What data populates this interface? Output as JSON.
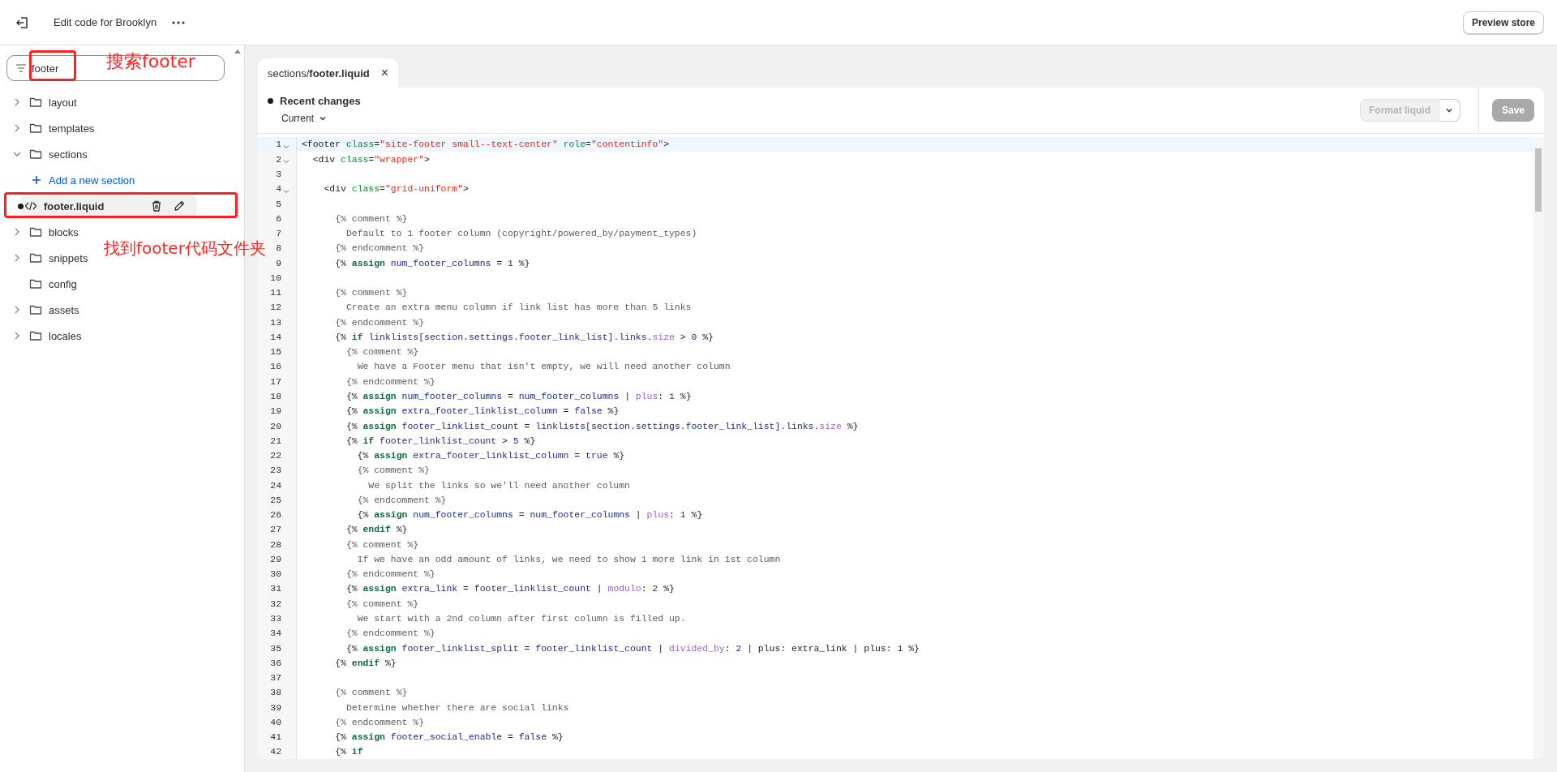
{
  "topbar": {
    "title": "Edit code for Brooklyn",
    "preview_button": "Preview store"
  },
  "search": {
    "value": "footer"
  },
  "tree": [
    {
      "kind": "folder",
      "label": "layout",
      "expanded": false
    },
    {
      "kind": "folder",
      "label": "templates",
      "expanded": false
    },
    {
      "kind": "folder",
      "label": "sections",
      "expanded": true,
      "children": [
        {
          "kind": "action",
          "label": "Add a new section"
        },
        {
          "kind": "file",
          "label": "footer.liquid",
          "selected": true,
          "modified": true
        }
      ]
    },
    {
      "kind": "folder",
      "label": "blocks",
      "expanded": false
    },
    {
      "kind": "folder",
      "label": "snippets",
      "expanded": false
    },
    {
      "kind": "plain-folder",
      "label": "config"
    },
    {
      "kind": "folder",
      "label": "assets",
      "expanded": false
    },
    {
      "kind": "folder",
      "label": "locales",
      "expanded": false
    }
  ],
  "editor": {
    "tab": {
      "label": "sections/**footer.liquid**",
      "close": "×"
    },
    "header": {
      "title": "Recent changes",
      "version": "Current"
    },
    "format_button": {
      "label": "Format liquid",
      "disabled": true
    },
    "save_button": {
      "label": "Save",
      "disabled": true
    },
    "lines": [
      {
        "n": "1",
        "fold": true,
        "active": true,
        "tokens": [
          {
            "kind": "tag",
            "text": "<footer "
          },
          {
            "kind": "attr",
            "text": "class"
          },
          {
            "kind": "tag",
            "text": "="
          },
          {
            "kind": "str",
            "text": "\"site-footer small--text-center\" "
          },
          {
            "kind": "attr",
            "text": "role"
          },
          {
            "kind": "tag",
            "text": "="
          },
          {
            "kind": "str",
            "text": "\"contentinfo\""
          },
          {
            "kind": "tag",
            "text": ">"
          }
        ]
      },
      {
        "n": "2",
        "fold": true,
        "active": false,
        "tokens": [
          {
            "kind": "tag",
            "text": "  <div "
          },
          {
            "kind": "attr",
            "text": "class"
          },
          {
            "kind": "tag",
            "text": "="
          },
          {
            "kind": "str",
            "text": "\"wrapper\""
          },
          {
            "kind": "tag",
            "text": ">"
          }
        ]
      },
      {
        "n": "3",
        "fold": false,
        "active": false
      },
      {
        "n": "4",
        "fold": true,
        "active": false,
        "tokens": [
          {
            "kind": "tag",
            "text": "    <div "
          },
          {
            "kind": "attr",
            "text": "class"
          },
          {
            "kind": "tag",
            "text": "="
          },
          {
            "kind": "str",
            "text": "\"grid-uniform\""
          },
          {
            "kind": "tag",
            "text": ">"
          }
        ]
      },
      {
        "n": "5",
        "fold": false,
        "active": false
      },
      {
        "n": "6",
        "fold": false,
        "active": false,
        "tokens": [
          {
            "kind": "cmt",
            "text": "      {% comment %}"
          }
        ]
      },
      {
        "n": "7",
        "fold": false,
        "active": false,
        "tokens": [
          {
            "kind": "cmt",
            "text": "        Default to 1 footer column (copyright/powered_by/payment_types)"
          }
        ]
      },
      {
        "n": "8",
        "fold": false,
        "active": false,
        "tokens": [
          {
            "kind": "cmt",
            "text": "      {% endcomment %}"
          }
        ]
      },
      {
        "n": "9",
        "fold": false,
        "active": false,
        "tokens": [
          {
            "kind": "text",
            "text": "      {% "
          },
          {
            "kind": "kw",
            "text": "assign"
          },
          {
            "kind": "var",
            "text": " num_footer_columns "
          },
          {
            "kind": "text",
            "text": "= "
          },
          {
            "kind": "var",
            "text": "1"
          },
          {
            "kind": "text",
            "text": " %}"
          }
        ]
      },
      {
        "n": "10",
        "fold": false,
        "active": false
      },
      {
        "n": "11",
        "fold": false,
        "active": false,
        "tokens": [
          {
            "kind": "cmt",
            "text": "      {% comment %}"
          }
        ]
      },
      {
        "n": "12",
        "fold": false,
        "active": false,
        "tokens": [
          {
            "kind": "cmt",
            "text": "        Create an extra menu column if link list has more than 5 links"
          }
        ]
      },
      {
        "n": "13",
        "fold": false,
        "active": false,
        "tokens": [
          {
            "kind": "cmt",
            "text": "      {% endcomment %}"
          }
        ]
      },
      {
        "n": "14",
        "fold": false,
        "active": false,
        "tokens": [
          {
            "kind": "text",
            "text": "      {% "
          },
          {
            "kind": "kw",
            "text": "if"
          },
          {
            "kind": "var",
            "text": " linklists[section.settings.footer_link_list].links."
          },
          {
            "kind": "filter",
            "text": "size"
          },
          {
            "kind": "text",
            "text": " > "
          },
          {
            "kind": "var",
            "text": "0"
          },
          {
            "kind": "text",
            "text": " %}"
          }
        ]
      },
      {
        "n": "15",
        "fold": false,
        "active": false,
        "tokens": [
          {
            "kind": "cmt",
            "text": "        {% comment %}"
          }
        ]
      },
      {
        "n": "16",
        "fold": false,
        "active": false,
        "tokens": [
          {
            "kind": "cmt",
            "text": "          We have a Footer menu that isn't empty, we will need another column"
          }
        ]
      },
      {
        "n": "17",
        "fold": false,
        "active": false,
        "tokens": [
          {
            "kind": "cmt",
            "text": "        {% endcomment %}"
          }
        ]
      },
      {
        "n": "18",
        "fold": false,
        "active": false,
        "tokens": [
          {
            "kind": "text",
            "text": "        {% "
          },
          {
            "kind": "kw",
            "text": "assign"
          },
          {
            "kind": "var",
            "text": " num_footer_columns "
          },
          {
            "kind": "text",
            "text": "= "
          },
          {
            "kind": "var",
            "text": "num_footer_columns "
          },
          {
            "kind": "text",
            "text": "| "
          },
          {
            "kind": "filter",
            "text": "plus"
          },
          {
            "kind": "text",
            "text": ": "
          },
          {
            "kind": "var",
            "text": "1"
          },
          {
            "kind": "text",
            "text": " %}"
          }
        ]
      },
      {
        "n": "19",
        "fold": false,
        "active": false,
        "tokens": [
          {
            "kind": "text",
            "text": "        {% "
          },
          {
            "kind": "kw",
            "text": "assign"
          },
          {
            "kind": "var",
            "text": " extra_footer_linklist_column "
          },
          {
            "kind": "text",
            "text": "= "
          },
          {
            "kind": "var",
            "text": "false"
          },
          {
            "kind": "text",
            "text": " %}"
          }
        ]
      },
      {
        "n": "20",
        "fold": false,
        "active": false,
        "tokens": [
          {
            "kind": "text",
            "text": "        {% "
          },
          {
            "kind": "kw",
            "text": "assign"
          },
          {
            "kind": "var",
            "text": " footer_linklist_count "
          },
          {
            "kind": "text",
            "text": "= "
          },
          {
            "kind": "var",
            "text": "linklists[section.settings.footer_link_list].links."
          },
          {
            "kind": "filter",
            "text": "size"
          },
          {
            "kind": "text",
            "text": " %}"
          }
        ]
      },
      {
        "n": "21",
        "fold": false,
        "active": false,
        "tokens": [
          {
            "kind": "text",
            "text": "        {% "
          },
          {
            "kind": "kw",
            "text": "if"
          },
          {
            "kind": "var",
            "text": " footer_linklist_count "
          },
          {
            "kind": "text",
            "text": "> "
          },
          {
            "kind": "var",
            "text": "5"
          },
          {
            "kind": "text",
            "text": " %}"
          }
        ]
      },
      {
        "n": "22",
        "fold": false,
        "active": false,
        "tokens": [
          {
            "kind": "text",
            "text": "          {% "
          },
          {
            "kind": "kw",
            "text": "assign"
          },
          {
            "kind": "var",
            "text": " extra_footer_linklist_column "
          },
          {
            "kind": "text",
            "text": "= "
          },
          {
            "kind": "var",
            "text": "true"
          },
          {
            "kind": "text",
            "text": " %}"
          }
        ]
      },
      {
        "n": "23",
        "fold": false,
        "active": false,
        "tokens": [
          {
            "kind": "cmt",
            "text": "          {% comment %}"
          }
        ]
      },
      {
        "n": "24",
        "fold": false,
        "active": false,
        "tokens": [
          {
            "kind": "cmt",
            "text": "            We split the links so we'll need another column"
          }
        ]
      },
      {
        "n": "25",
        "fold": false,
        "active": false,
        "tokens": [
          {
            "kind": "cmt",
            "text": "          {% endcomment %}"
          }
        ]
      },
      {
        "n": "26",
        "fold": false,
        "active": false,
        "tokens": [
          {
            "kind": "text",
            "text": "          {% "
          },
          {
            "kind": "kw",
            "text": "assign"
          },
          {
            "kind": "var",
            "text": " num_footer_columns "
          },
          {
            "kind": "text",
            "text": "= "
          },
          {
            "kind": "var",
            "text": "num_footer_columns "
          },
          {
            "kind": "text",
            "text": "| "
          },
          {
            "kind": "filter",
            "text": "plus"
          },
          {
            "kind": "text",
            "text": ": "
          },
          {
            "kind": "var",
            "text": "1"
          },
          {
            "kind": "text",
            "text": " %}"
          }
        ]
      },
      {
        "n": "27",
        "fold": false,
        "active": false,
        "tokens": [
          {
            "kind": "text",
            "text": "        {% "
          },
          {
            "kind": "kw",
            "text": "endif"
          },
          {
            "kind": "text",
            "text": " %}"
          }
        ]
      },
      {
        "n": "28",
        "fold": false,
        "active": false,
        "tokens": [
          {
            "kind": "cmt",
            "text": "        {% comment %}"
          }
        ]
      },
      {
        "n": "29",
        "fold": false,
        "active": false,
        "tokens": [
          {
            "kind": "cmt",
            "text": "          If we have an odd amount of links, we need to show 1 more link in 1st column"
          }
        ]
      },
      {
        "n": "30",
        "fold": false,
        "active": false,
        "tokens": [
          {
            "kind": "cmt",
            "text": "        {% endcomment %}"
          }
        ]
      },
      {
        "n": "31",
        "fold": false,
        "active": false,
        "tokens": [
          {
            "kind": "text",
            "text": "        {% "
          },
          {
            "kind": "kw",
            "text": "assign"
          },
          {
            "kind": "var",
            "text": " extra_link "
          },
          {
            "kind": "text",
            "text": "= "
          },
          {
            "kind": "var",
            "text": "footer_linklist_count "
          },
          {
            "kind": "text",
            "text": "| "
          },
          {
            "kind": "filter",
            "text": "modulo"
          },
          {
            "kind": "text",
            "text": ": "
          },
          {
            "kind": "var",
            "text": "2"
          },
          {
            "kind": "text",
            "text": " %}"
          }
        ]
      },
      {
        "n": "32",
        "fold": false,
        "active": false,
        "tokens": [
          {
            "kind": "cmt",
            "text": "        {% comment %}"
          }
        ]
      },
      {
        "n": "33",
        "fold": false,
        "active": false,
        "tokens": [
          {
            "kind": "cmt",
            "text": "          We start with a 2nd column after first column is filled up."
          }
        ]
      },
      {
        "n": "34",
        "fold": false,
        "active": false,
        "tokens": [
          {
            "kind": "cmt",
            "text": "        {% endcomment %}"
          }
        ]
      },
      {
        "n": "35",
        "fold": false,
        "active": false,
        "tokens": [
          {
            "kind": "text",
            "text": "        {% "
          },
          {
            "kind": "kw",
            "text": "assign"
          },
          {
            "kind": "var",
            "text": " footer_linklist_split "
          },
          {
            "kind": "text",
            "text": "= "
          },
          {
            "kind": "var",
            "text": "footer_linklist_count "
          },
          {
            "kind": "text",
            "text": "| "
          },
          {
            "kind": "filter",
            "text": "divided_by"
          },
          {
            "kind": "text",
            "text": ": "
          },
          {
            "kind": "var",
            "text": "2"
          },
          {
            "kind": "text",
            "text": " | plus: extra_link | plus: 1 %}"
          }
        ]
      },
      {
        "n": "36",
        "fold": false,
        "active": false,
        "tokens": [
          {
            "kind": "text",
            "text": "      {% "
          },
          {
            "kind": "kw",
            "text": "endif"
          },
          {
            "kind": "text",
            "text": " %}"
          }
        ]
      },
      {
        "n": "37",
        "fold": false,
        "active": false
      },
      {
        "n": "38",
        "fold": false,
        "active": false,
        "tokens": [
          {
            "kind": "cmt",
            "text": "      {% comment %}"
          }
        ]
      },
      {
        "n": "39",
        "fold": false,
        "active": false,
        "tokens": [
          {
            "kind": "cmt",
            "text": "        Determine whether there are social links"
          }
        ]
      },
      {
        "n": "40",
        "fold": false,
        "active": false,
        "tokens": [
          {
            "kind": "cmt",
            "text": "      {% endcomment %}"
          }
        ]
      },
      {
        "n": "41",
        "fold": false,
        "active": false,
        "tokens": [
          {
            "kind": "text",
            "text": "      {% "
          },
          {
            "kind": "kw",
            "text": "assign"
          },
          {
            "kind": "var",
            "text": " footer_social_enable "
          },
          {
            "kind": "text",
            "text": "= "
          },
          {
            "kind": "var",
            "text": "false"
          },
          {
            "kind": "text",
            "text": " %}"
          }
        ]
      },
      {
        "n": "42",
        "fold": false,
        "active": false,
        "tokens": [
          {
            "kind": "text",
            "text": "      {% "
          },
          {
            "kind": "kw",
            "text": "if"
          }
        ]
      }
    ]
  },
  "annotations": [
    {
      "kind": "box"
    },
    {
      "kind": "label",
      "text": "搜索footer"
    },
    {
      "kind": "box"
    },
    {
      "kind": "label",
      "text": "找到footer代码文件夹"
    }
  ]
}
